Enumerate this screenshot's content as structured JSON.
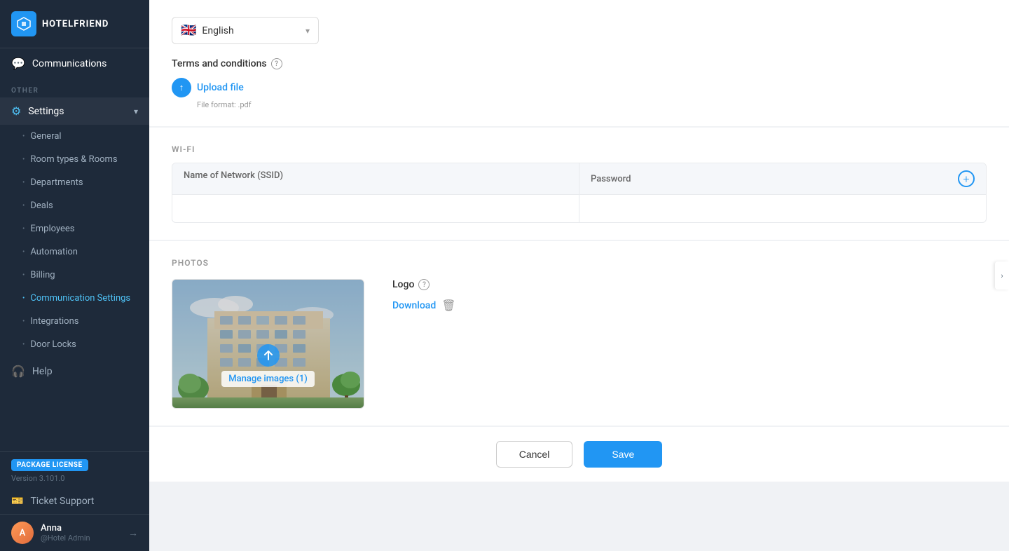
{
  "app": {
    "name": "HOTELFRIEND",
    "version": "Version 3.101.0",
    "package_label": "PACKAGE LICENSE"
  },
  "sidebar": {
    "communications_label": "Communications",
    "other_label": "OTHER",
    "settings_label": "Settings",
    "submenu": {
      "general": "General",
      "room_types": "Room types & Rooms",
      "departments": "Departments",
      "deals": "Deals",
      "employees": "Employees",
      "automation": "Automation",
      "billing": "Billing",
      "communication_settings": "Communication Settings",
      "integrations": "Integrations",
      "door_locks": "Door Locks"
    },
    "help_label": "Help",
    "ticket_support_label": "Ticket Support"
  },
  "user": {
    "name": "Anna",
    "role": "@Hotel Admin",
    "initials": "A"
  },
  "language_selector": {
    "selected": "English",
    "flag": "🇬🇧"
  },
  "terms": {
    "title": "Terms and conditions",
    "upload_label": "Upload file",
    "file_format_hint": "File format: .pdf"
  },
  "wifi": {
    "section_label": "WI-FI",
    "ssid_placeholder": "Name of Network (SSID)",
    "password_placeholder": "Password"
  },
  "photos": {
    "section_label": "PHOTOS",
    "manage_images_label": "Manage images (1)",
    "logo_label": "Logo",
    "download_label": "Download"
  },
  "buttons": {
    "cancel": "Cancel",
    "save": "Save"
  },
  "icons": {
    "chevron_down": "▾",
    "chevron_left": "‹",
    "chevron_right": "›",
    "plus": "+",
    "upload_arrow": "↑",
    "cloud_upload": "☁",
    "trash": "🗑",
    "help": "?",
    "logout": "→"
  }
}
